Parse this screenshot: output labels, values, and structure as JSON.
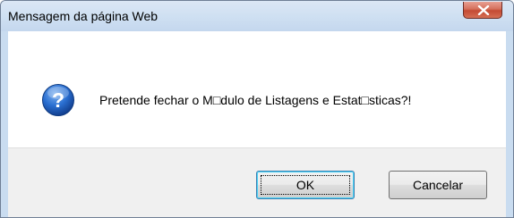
{
  "dialog": {
    "title": "Mensagem da página Web",
    "message": "Pretende fechar o M□dulo de Listagens e Estat□sticas?!",
    "icon": "question-icon",
    "ok_label": "OK",
    "cancel_label": "Cancelar",
    "close_icon": "close-icon"
  },
  "colors": {
    "close_button": "#c44a33",
    "frame": "#c9dcf0",
    "icon_blue": "#1f5bb8",
    "ok_focus": "#48d3f7"
  }
}
